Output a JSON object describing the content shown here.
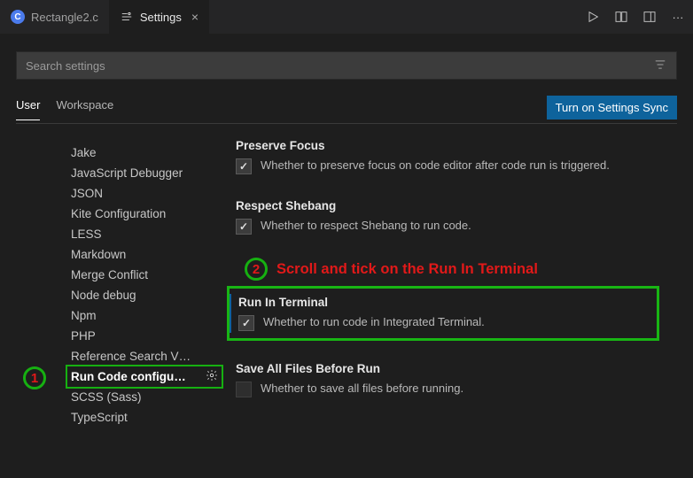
{
  "tabs": {
    "file": {
      "icon_letter": "C",
      "label": "Rectangle2.c"
    },
    "settings": {
      "label": "Settings"
    }
  },
  "search": {
    "placeholder": "Search settings"
  },
  "scopes": {
    "user": "User",
    "workspace": "Workspace"
  },
  "sync_button": "Turn on Settings Sync",
  "tree": {
    "items": [
      "Jake",
      "JavaScript Debugger",
      "JSON",
      "Kite Configuration",
      "LESS",
      "Markdown",
      "Merge Conflict",
      "Node debug",
      "Npm",
      "PHP",
      "Reference Search V…",
      "Run Code configu…",
      "SCSS (Sass)",
      "TypeScript"
    ],
    "selected_index": 11
  },
  "settings": {
    "preserve_focus": {
      "title": "Preserve Focus",
      "desc": "Whether to preserve focus on code editor after code run is triggered.",
      "checked": true
    },
    "respect_shebang": {
      "title": "Respect Shebang",
      "desc": "Whether to respect Shebang to run code.",
      "checked": true
    },
    "run_in_terminal": {
      "title": "Run In Terminal",
      "desc": "Whether to run code in Integrated Terminal.",
      "checked": true
    },
    "save_all": {
      "title": "Save All Files Before Run",
      "desc": "Whether to save all files before running.",
      "checked": false
    }
  },
  "annotations": {
    "left": "1",
    "top": {
      "num": "2",
      "text": "Scroll and tick on the Run In Terminal"
    }
  }
}
